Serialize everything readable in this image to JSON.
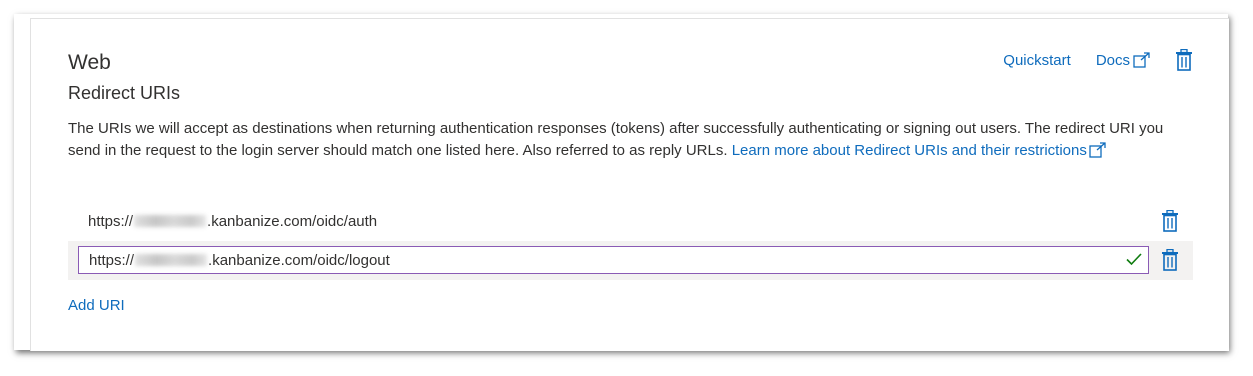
{
  "section": {
    "title": "Web",
    "subtitle": "Redirect URIs",
    "description": "The URIs we will accept as destinations when returning authentication responses (tokens) after successfully authenticating or signing out users. The redirect URI you send in the request to the login server should match one listed here. Also referred to as reply URLs. ",
    "learn_more_link": "Learn more about Redirect URIs and their restrictions"
  },
  "actions": {
    "quickstart": "Quickstart",
    "docs": "Docs"
  },
  "redirect_uris": [
    {
      "prefix": "https://",
      "suffix": ".kanbanize.com/oidc/auth"
    },
    {
      "value": "https://xxxxxxxxx.kanbanize.com/oidc/logout",
      "prefix": "https://",
      "suffix": ".kanbanize.com/oidc/logout",
      "valid": true
    }
  ],
  "add_uri": "Add URI",
  "icons": {
    "delete": "trash-icon",
    "external": "external-link-icon",
    "valid": "checkmark-icon"
  },
  "colors": {
    "link": "#0f6cbd",
    "text": "#323130",
    "input_focus_border": "#8a5bb5",
    "valid_check": "#107c10",
    "row_highlight": "#f3f2f1"
  }
}
